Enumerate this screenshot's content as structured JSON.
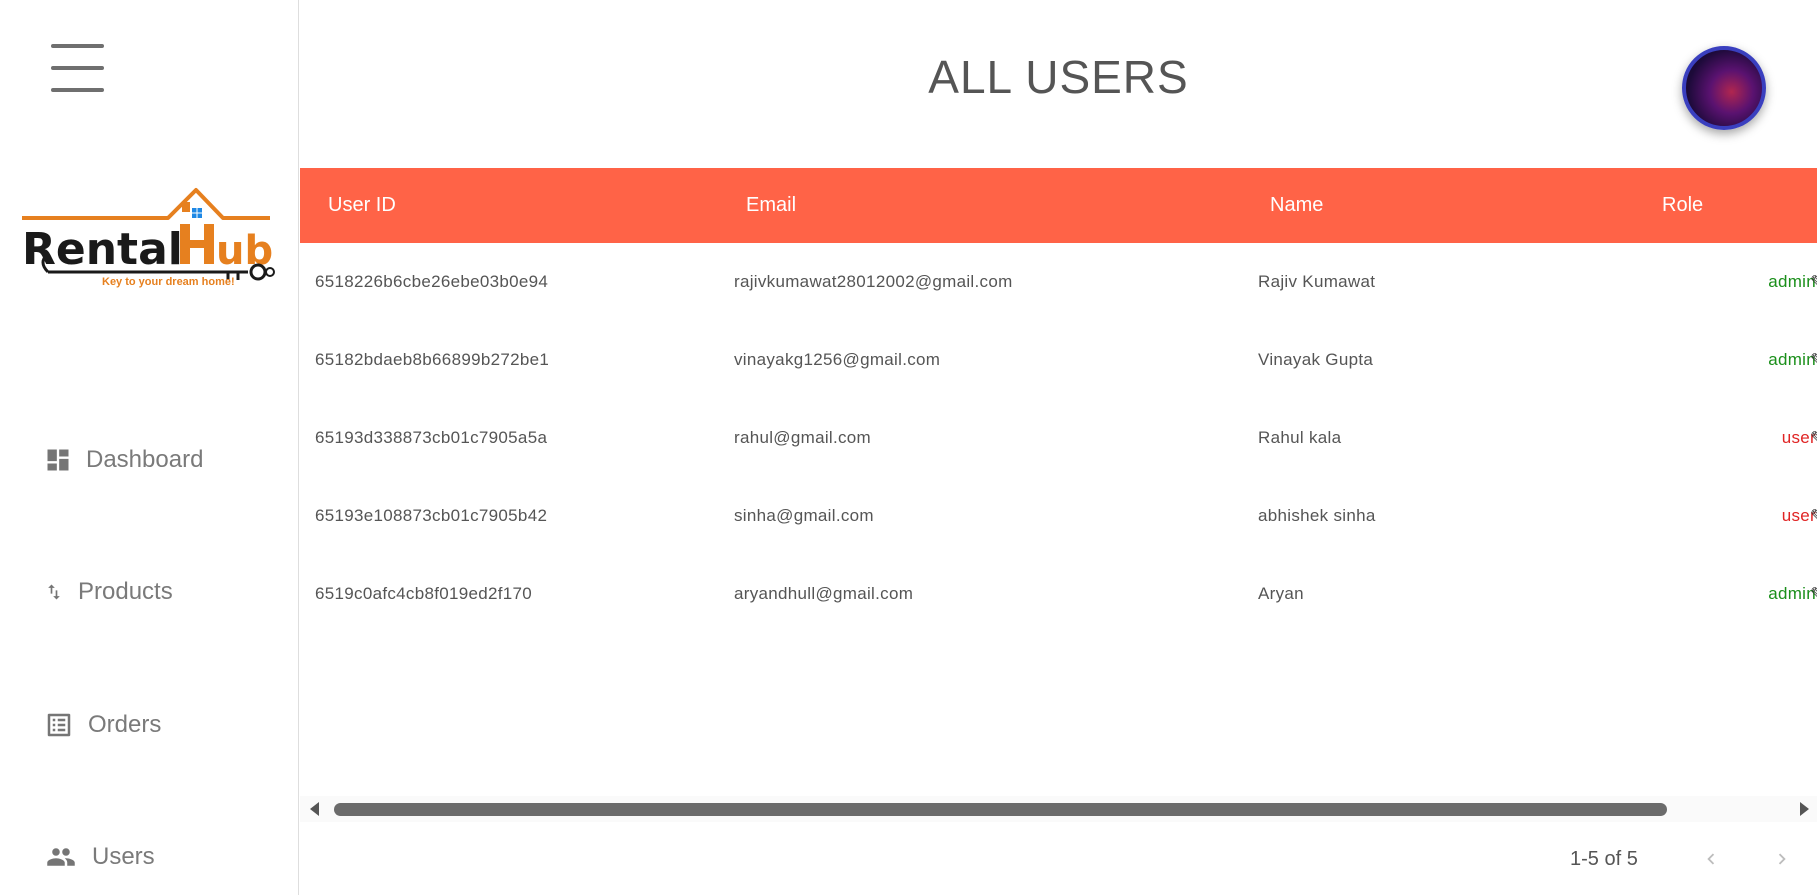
{
  "sidebar": {
    "logo": {
      "brand": "RentalHub",
      "tagline": "Key to your dream home!"
    },
    "items": [
      {
        "label": "Dashboard",
        "icon": "dashboard-icon"
      },
      {
        "label": "Products",
        "icon": "swap-vert-icon"
      },
      {
        "label": "Orders",
        "icon": "list-alt-icon"
      },
      {
        "label": "Users",
        "icon": "people-icon"
      }
    ]
  },
  "header": {
    "title": "ALL USERS"
  },
  "table": {
    "columns": [
      "User ID",
      "Email",
      "Name",
      "Role"
    ],
    "rows": [
      {
        "id": "6518226b6cbe26ebe03b0e94",
        "email": "rajivkumawat28012002@gmail.com",
        "name": "Rajiv Kumawat",
        "role": "admin"
      },
      {
        "id": "65182bdaeb8b66899b272be1",
        "email": "vinayakg1256@gmail.com",
        "name": "Vinayak Gupta",
        "role": "admin"
      },
      {
        "id": "65193d338873cb01c7905a5a",
        "email": "rahul@gmail.com",
        "name": "Rahul kala",
        "role": "user"
      },
      {
        "id": "65193e108873cb01c7905b42",
        "email": "sinha@gmail.com",
        "name": "abhishek sinha",
        "role": "user"
      },
      {
        "id": "6519c0afc4cb8f019ed2f170",
        "email": "aryandhull@gmail.com",
        "name": "Aryan",
        "role": "admin"
      }
    ]
  },
  "pagination": {
    "range_text": "1-5 of 5"
  },
  "colors": {
    "header_bg": "#ff6347",
    "admin": "#1a8f1a",
    "user": "#e02424",
    "avatar_border": "#3a3fbf"
  }
}
